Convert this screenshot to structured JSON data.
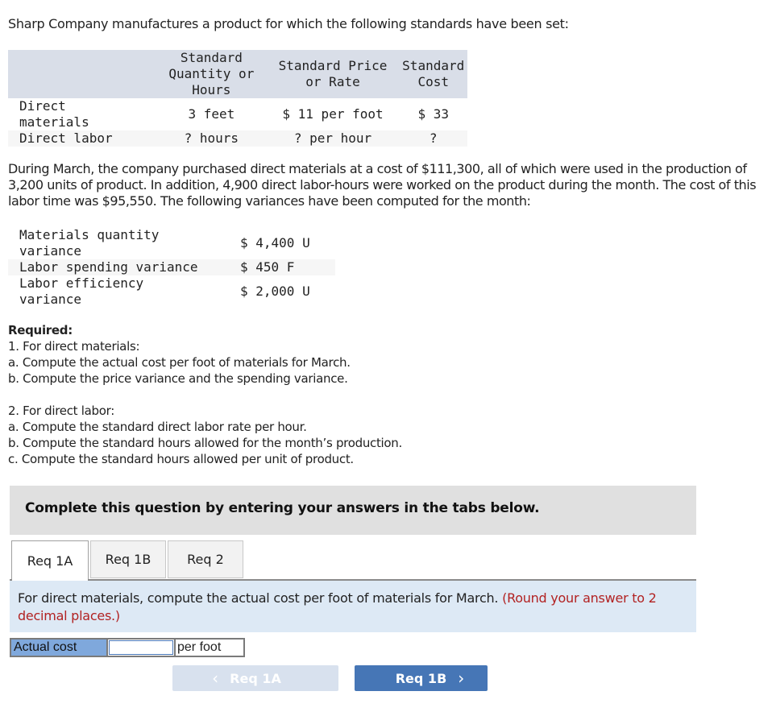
{
  "intro": "Sharp Company manufactures a product for which the following standards have been set:",
  "standards_table": {
    "headers": [
      "",
      "Standard Quantity or Hours",
      "Standard Price or Rate",
      "Standard Cost"
    ],
    "header_lines": {
      "qty": [
        "Standard",
        "Quantity or",
        "Hours"
      ],
      "price": [
        "Standard Price",
        "or Rate"
      ],
      "cost": [
        "Standard",
        "Cost"
      ]
    },
    "rows": [
      {
        "label": "Direct materials",
        "label_lines": [
          "Direct",
          "materials"
        ],
        "quantity": "3 feet",
        "price": "$ 11 per foot",
        "cost": "$ 33"
      },
      {
        "label": "Direct labor",
        "quantity": "? hours",
        "price": "? per hour",
        "cost": "?"
      }
    ]
  },
  "paragraph": "During March, the company purchased direct materials at a cost of $111,300, all of which were used in the production of 3,200 units of product. In addition, 4,900 direct labor-hours were worked on the product during the month. The cost of this labor time was $95,550. The following variances have been computed for the month:",
  "variances": [
    {
      "label_lines": [
        "Materials quantity",
        "variance"
      ],
      "value": "$ 4,400 U"
    },
    {
      "label_lines": [
        "Labor spending variance"
      ],
      "value": "$ 450 F"
    },
    {
      "label_lines": [
        "Labor efficiency",
        "variance"
      ],
      "value": "$ 2,000 U"
    }
  ],
  "required": {
    "heading": "Required:",
    "part1": [
      "1. For direct materials:",
      "a. Compute the actual cost per foot of materials for March.",
      "b. Compute the price variance and the spending variance."
    ],
    "part2": [
      "2. For direct labor:",
      "a. Compute the standard direct labor rate per hour.",
      "b. Compute the standard hours allowed for the month’s production.",
      "c. Compute the standard hours allowed per unit of product."
    ]
  },
  "banner": "Complete this question by entering your answers in the tabs below.",
  "tabs": [
    {
      "label": "Req 1A",
      "active": true
    },
    {
      "label": "Req 1B",
      "active": false
    },
    {
      "label": "Req 2",
      "active": false
    }
  ],
  "instruction": {
    "text": "For direct materials, compute the actual cost per foot of materials for March.",
    "note": "(Round your answer to 2 decimal places.)"
  },
  "answer": {
    "label": "Actual cost",
    "value": "",
    "unit": "per foot"
  },
  "nav": {
    "prev_label": "Req 1A",
    "next_label": "Req 1B",
    "prev_icon": "chevron-left-icon",
    "next_icon": "chevron-right-icon"
  },
  "colors": {
    "table_header_bg": "#d9dee8",
    "banner_bg": "#e0e0e0",
    "instruction_bg": "#dde9f5",
    "note_red": "#b22222",
    "answer_label_bg": "#7fa8dc",
    "next_button": "#4676b6",
    "prev_button_disabled": "#d8e1ee"
  }
}
